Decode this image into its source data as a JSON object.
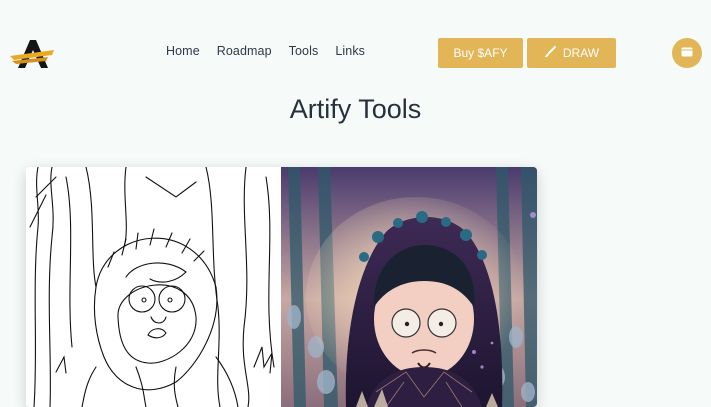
{
  "header": {
    "nav": [
      "Home",
      "Roadmap",
      "Tools",
      "Links"
    ],
    "buy_label": "Buy $AFY",
    "draw_label": "DRAW"
  },
  "main": {
    "title": "Artify Tools"
  },
  "colors": {
    "accent": "#e2b556",
    "background": "#f6faf8",
    "text": "#26313d"
  },
  "icons": {
    "logo": "artify-logo",
    "draw": "brush-icon",
    "wallet": "wallet-icon"
  }
}
